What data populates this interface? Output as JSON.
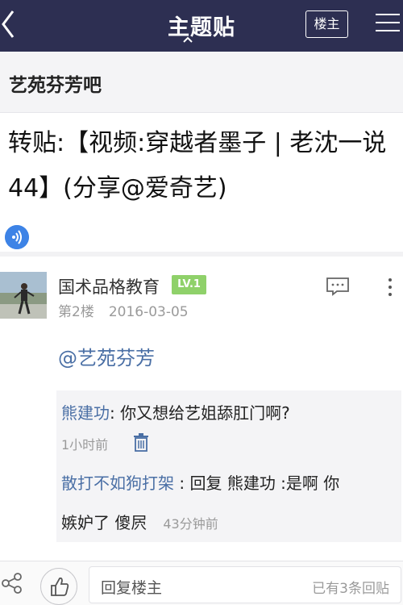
{
  "nav": {
    "title": "主题贴",
    "louzhu_label": "楼主",
    "back_icon": "chevron-left-icon",
    "menu_icon": "hamburger-menu-icon",
    "bg_color": "#2d2f52"
  },
  "forum": {
    "name": "艺苑芬芳吧"
  },
  "post": {
    "title": "转贴:【视频:穿越者墨子 | 老沈一说44】(分享@爱奇艺)",
    "audio_icon": "speaker-icon"
  },
  "floor": {
    "user_name": "国术品格教育",
    "level_badge": "LV.1",
    "floor_label": "第2楼",
    "date": "2016-03-05",
    "content": "@艺苑芬芳",
    "replies": [
      {
        "author": "熊建功",
        "sep": ":",
        "text": "你又想给艺姐舔肛门啊?",
        "time": "1小时前"
      },
      {
        "author": "散打不如狗打架",
        "sep": ":",
        "text": "回复 熊建功 :是啊 你",
        "text_cont": "嫉妒了 傻屄",
        "time": "43分钟前"
      }
    ]
  },
  "bottom": {
    "reply_placeholder": "回复楼主",
    "reply_count": "已有3条回贴"
  },
  "colors": {
    "link": "#4a6fa5",
    "badge": "#8fd16a",
    "accent": "#3d83e6"
  }
}
